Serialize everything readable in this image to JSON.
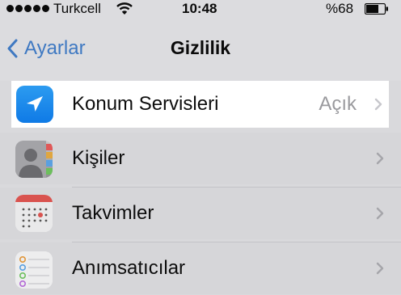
{
  "status_bar": {
    "carrier": "Turkcell",
    "time": "10:48",
    "battery_percent": "%68",
    "battery_level": 0.68
  },
  "nav": {
    "back_label": "Ayarlar",
    "title": "Gizlilik"
  },
  "rows": [
    {
      "label": "Konum Servisleri",
      "value": "Açık",
      "icon": "location-arrow-icon"
    },
    {
      "label": "Kişiler",
      "icon": "contacts-icon"
    },
    {
      "label": "Takvimler",
      "icon": "calendar-icon"
    },
    {
      "label": "Anımsatıcılar",
      "icon": "reminders-icon"
    }
  ],
  "colors": {
    "accent": "#3f79c2",
    "highlight": "#ffffff",
    "dimmed_background": "#d9d9dc",
    "location_icon": "#1888ec"
  }
}
